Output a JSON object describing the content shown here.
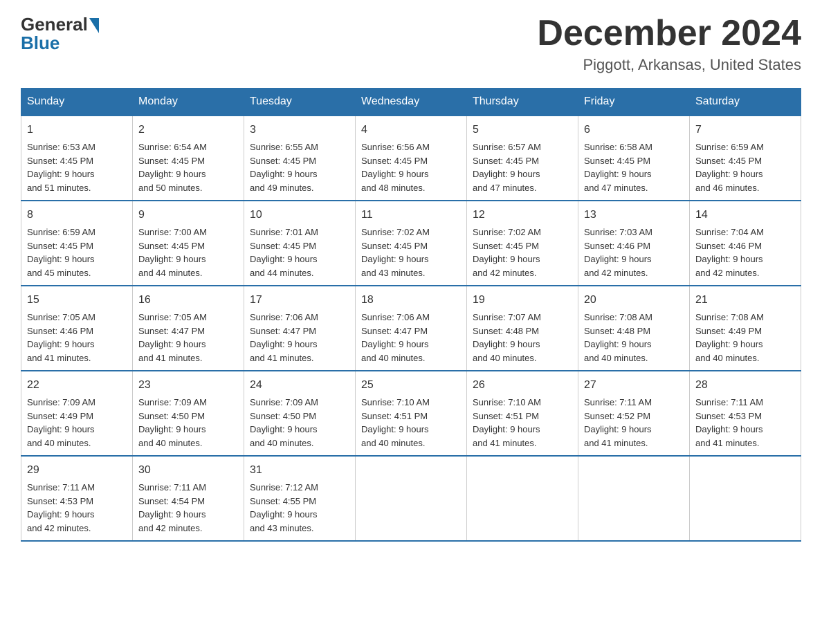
{
  "header": {
    "logo_general": "General",
    "logo_blue": "Blue",
    "month_title": "December 2024",
    "location": "Piggott, Arkansas, United States"
  },
  "weekdays": [
    "Sunday",
    "Monday",
    "Tuesday",
    "Wednesday",
    "Thursday",
    "Friday",
    "Saturday"
  ],
  "weeks": [
    [
      {
        "day": "1",
        "sunrise": "6:53 AM",
        "sunset": "4:45 PM",
        "daylight": "9 hours and 51 minutes."
      },
      {
        "day": "2",
        "sunrise": "6:54 AM",
        "sunset": "4:45 PM",
        "daylight": "9 hours and 50 minutes."
      },
      {
        "day": "3",
        "sunrise": "6:55 AM",
        "sunset": "4:45 PM",
        "daylight": "9 hours and 49 minutes."
      },
      {
        "day": "4",
        "sunrise": "6:56 AM",
        "sunset": "4:45 PM",
        "daylight": "9 hours and 48 minutes."
      },
      {
        "day": "5",
        "sunrise": "6:57 AM",
        "sunset": "4:45 PM",
        "daylight": "9 hours and 47 minutes."
      },
      {
        "day": "6",
        "sunrise": "6:58 AM",
        "sunset": "4:45 PM",
        "daylight": "9 hours and 47 minutes."
      },
      {
        "day": "7",
        "sunrise": "6:59 AM",
        "sunset": "4:45 PM",
        "daylight": "9 hours and 46 minutes."
      }
    ],
    [
      {
        "day": "8",
        "sunrise": "6:59 AM",
        "sunset": "4:45 PM",
        "daylight": "9 hours and 45 minutes."
      },
      {
        "day": "9",
        "sunrise": "7:00 AM",
        "sunset": "4:45 PM",
        "daylight": "9 hours and 44 minutes."
      },
      {
        "day": "10",
        "sunrise": "7:01 AM",
        "sunset": "4:45 PM",
        "daylight": "9 hours and 44 minutes."
      },
      {
        "day": "11",
        "sunrise": "7:02 AM",
        "sunset": "4:45 PM",
        "daylight": "9 hours and 43 minutes."
      },
      {
        "day": "12",
        "sunrise": "7:02 AM",
        "sunset": "4:45 PM",
        "daylight": "9 hours and 42 minutes."
      },
      {
        "day": "13",
        "sunrise": "7:03 AM",
        "sunset": "4:46 PM",
        "daylight": "9 hours and 42 minutes."
      },
      {
        "day": "14",
        "sunrise": "7:04 AM",
        "sunset": "4:46 PM",
        "daylight": "9 hours and 42 minutes."
      }
    ],
    [
      {
        "day": "15",
        "sunrise": "7:05 AM",
        "sunset": "4:46 PM",
        "daylight": "9 hours and 41 minutes."
      },
      {
        "day": "16",
        "sunrise": "7:05 AM",
        "sunset": "4:47 PM",
        "daylight": "9 hours and 41 minutes."
      },
      {
        "day": "17",
        "sunrise": "7:06 AM",
        "sunset": "4:47 PM",
        "daylight": "9 hours and 41 minutes."
      },
      {
        "day": "18",
        "sunrise": "7:06 AM",
        "sunset": "4:47 PM",
        "daylight": "9 hours and 40 minutes."
      },
      {
        "day": "19",
        "sunrise": "7:07 AM",
        "sunset": "4:48 PM",
        "daylight": "9 hours and 40 minutes."
      },
      {
        "day": "20",
        "sunrise": "7:08 AM",
        "sunset": "4:48 PM",
        "daylight": "9 hours and 40 minutes."
      },
      {
        "day": "21",
        "sunrise": "7:08 AM",
        "sunset": "4:49 PM",
        "daylight": "9 hours and 40 minutes."
      }
    ],
    [
      {
        "day": "22",
        "sunrise": "7:09 AM",
        "sunset": "4:49 PM",
        "daylight": "9 hours and 40 minutes."
      },
      {
        "day": "23",
        "sunrise": "7:09 AM",
        "sunset": "4:50 PM",
        "daylight": "9 hours and 40 minutes."
      },
      {
        "day": "24",
        "sunrise": "7:09 AM",
        "sunset": "4:50 PM",
        "daylight": "9 hours and 40 minutes."
      },
      {
        "day": "25",
        "sunrise": "7:10 AM",
        "sunset": "4:51 PM",
        "daylight": "9 hours and 40 minutes."
      },
      {
        "day": "26",
        "sunrise": "7:10 AM",
        "sunset": "4:51 PM",
        "daylight": "9 hours and 41 minutes."
      },
      {
        "day": "27",
        "sunrise": "7:11 AM",
        "sunset": "4:52 PM",
        "daylight": "9 hours and 41 minutes."
      },
      {
        "day": "28",
        "sunrise": "7:11 AM",
        "sunset": "4:53 PM",
        "daylight": "9 hours and 41 minutes."
      }
    ],
    [
      {
        "day": "29",
        "sunrise": "7:11 AM",
        "sunset": "4:53 PM",
        "daylight": "9 hours and 42 minutes."
      },
      {
        "day": "30",
        "sunrise": "7:11 AM",
        "sunset": "4:54 PM",
        "daylight": "9 hours and 42 minutes."
      },
      {
        "day": "31",
        "sunrise": "7:12 AM",
        "sunset": "4:55 PM",
        "daylight": "9 hours and 43 minutes."
      },
      null,
      null,
      null,
      null
    ]
  ],
  "labels": {
    "sunrise": "Sunrise:",
    "sunset": "Sunset:",
    "daylight": "Daylight:"
  }
}
